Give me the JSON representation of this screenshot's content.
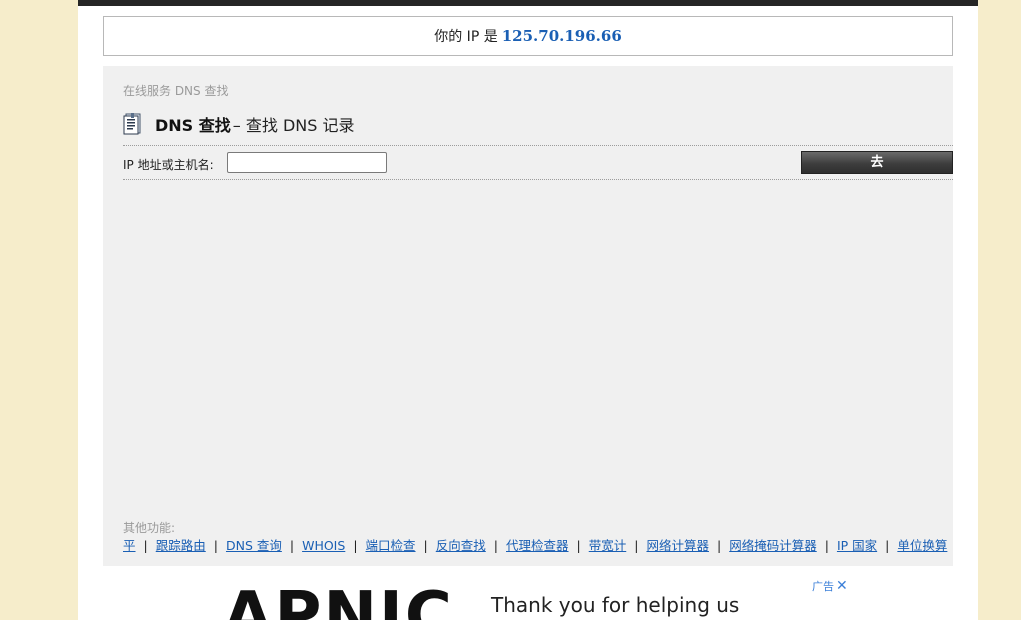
{
  "ip_banner": {
    "prefix": "你的 IP 是",
    "ip": "125.70.196.66"
  },
  "breadcrumb": "在线服务 DNS 查找",
  "heading": {
    "title": "DNS 查找",
    "subtitle": "– 查找 DNS 记录",
    "icon": "document-icon"
  },
  "form": {
    "label": "IP 地址或主机名:",
    "value": "",
    "placeholder": "",
    "submit": "去"
  },
  "other_features": {
    "label": "其他功能:",
    "links": [
      "平",
      "跟踪路由",
      "DNS 查询",
      "WHOIS",
      "端口检查",
      "反向查找",
      "代理检查器",
      "带宽计",
      "网络计算器",
      "网络掩码计算器",
      "IP 国家",
      "单位换算"
    ],
    "separator": "|"
  },
  "ad": {
    "brand": "APNIC",
    "message": "Thank you for helping us",
    "badge": "广告",
    "close": "✕"
  },
  "colors": {
    "background": "#f6edcb",
    "panel": "#f0f0f0",
    "link": "#1a5fb4",
    "topbar": "#262626"
  }
}
